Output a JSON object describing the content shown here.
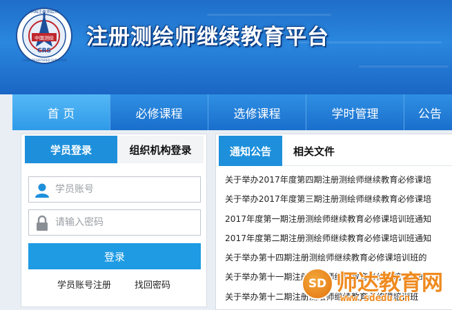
{
  "header": {
    "site_title": "注册测绘师继续教育平台",
    "logo": {
      "icon": "crs-compass-logo-icon",
      "lettering": [
        "中国注册测绘师",
        "中国测绘",
        "CRS",
        "CHINA REGISTERED SURVEYOR"
      ]
    },
    "colors": {
      "bg": "#1f6ec9",
      "title": "#ffffff"
    }
  },
  "nav": {
    "items": [
      {
        "label": "首 页",
        "active": true
      },
      {
        "label": "必修课程",
        "active": false
      },
      {
        "label": "选修课程",
        "active": false
      },
      {
        "label": "学时管理",
        "active": false
      },
      {
        "label": "公告",
        "active": false
      }
    ]
  },
  "login": {
    "tabs": [
      {
        "label": "学员登录",
        "active": true
      },
      {
        "label": "组织机构登录",
        "active": false
      }
    ],
    "account": {
      "placeholder": "学员账号",
      "icon": "user-icon"
    },
    "password": {
      "placeholder": "请输入密码",
      "icon": "lock-icon"
    },
    "submit_label": "登录",
    "register_label": "学员账号注册",
    "forgot_label": "找回密码"
  },
  "notices": {
    "tabs": [
      {
        "label": "通知公告",
        "active": true
      },
      {
        "label": "相关文件",
        "active": false
      }
    ],
    "items": [
      "关于举办2017年度第四期注册测绘师继续教育必修课培",
      "关于举办2017年度第三期注册测绘师继续教育必修课培",
      "2017年度第一期注册测绘师继续教育必修课培训班通知",
      "2017年度第二期注册测绘师继续教育必修课培训班通知",
      "关于举办第十四期注册测绘师继续教育必修课培训班的",
      "关于举办第十一期注册测绘师继续教育必修课培训班的",
      "关于举办第十二期注册测绘师继续教育必修课培训班"
    ]
  },
  "watermark": {
    "badge": "SD",
    "text": "师达教育网",
    "url": "www.sdedu.cn"
  },
  "accent_color": "#1e90db"
}
